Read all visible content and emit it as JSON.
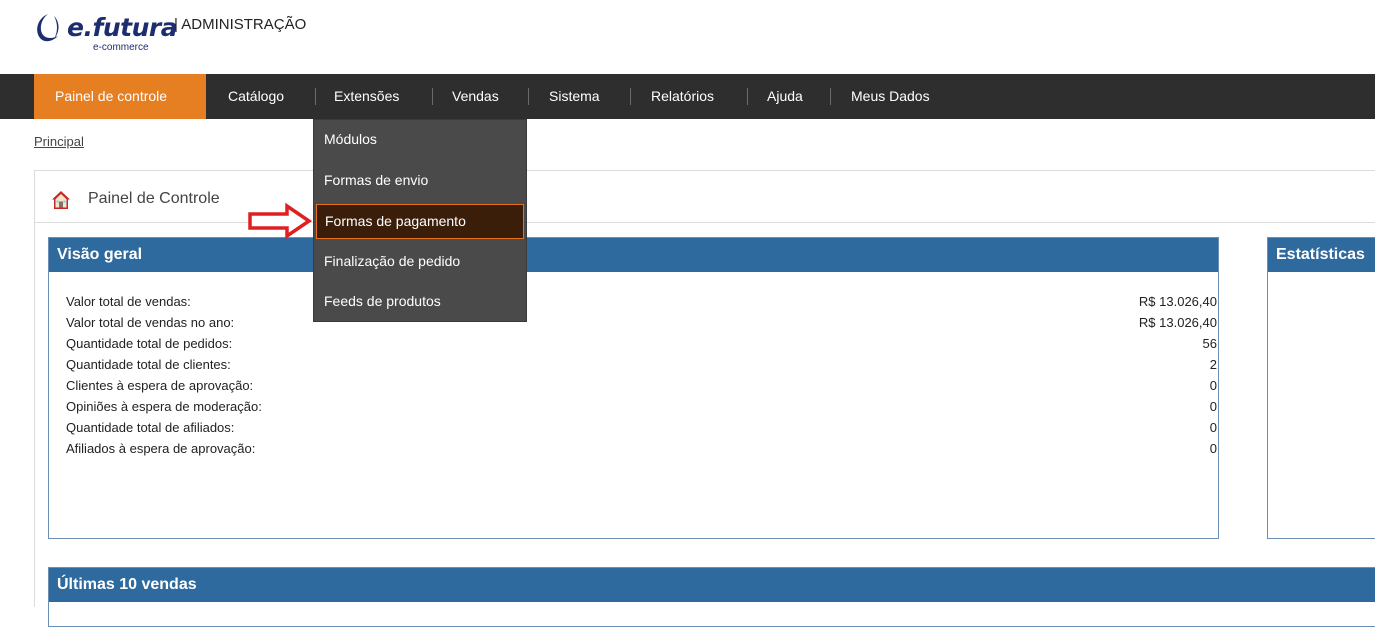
{
  "brand": {
    "name": "e.futura",
    "sub": "e-commerce",
    "section": "| ADMINISTRAÇÃO"
  },
  "nav": {
    "items": [
      {
        "label": "Painel de controle",
        "active": true
      },
      {
        "label": "Catálogo"
      },
      {
        "label": "Extensões"
      },
      {
        "label": "Vendas"
      },
      {
        "label": "Sistema"
      },
      {
        "label": "Relatórios"
      },
      {
        "label": "Ajuda"
      },
      {
        "label": "Meus Dados"
      }
    ],
    "accent": "#e67e22",
    "bar_color": "#2e2e2e"
  },
  "dropdown": {
    "items": [
      {
        "label": "Módulos"
      },
      {
        "label": "Formas de envio"
      },
      {
        "label": "Formas de pagamento",
        "highlighted": true
      },
      {
        "label": "Finalização de pedido"
      },
      {
        "label": "Feeds de produtos"
      }
    ]
  },
  "breadcrumb": "Principal",
  "page": {
    "title": "Painel de Controle",
    "icon": "home-icon"
  },
  "overview": {
    "title": "Visão geral",
    "rows": [
      {
        "label": "Valor total de vendas:",
        "value": "R$ 13.026,40"
      },
      {
        "label": "Valor total de vendas no ano:",
        "value": "R$ 13.026,40"
      },
      {
        "label": "Quantidade total de pedidos:",
        "value": "56"
      },
      {
        "label": "Quantidade total de clientes:",
        "value": "2"
      },
      {
        "label": "Clientes à espera de aprovação:",
        "value": "0"
      },
      {
        "label": "Opiniões à espera de moderação:",
        "value": "0"
      },
      {
        "label": "Quantidade total de afiliados:",
        "value": "0"
      },
      {
        "label": "Afiliados à espera de aprovação:",
        "value": "0"
      }
    ]
  },
  "stats": {
    "title": "Estatísticas"
  },
  "latest": {
    "title": "Últimas 10 vendas"
  },
  "colors": {
    "panel_header": "#2f6a9e",
    "highlight_border": "#e6721f",
    "arrow": "#e02020"
  }
}
